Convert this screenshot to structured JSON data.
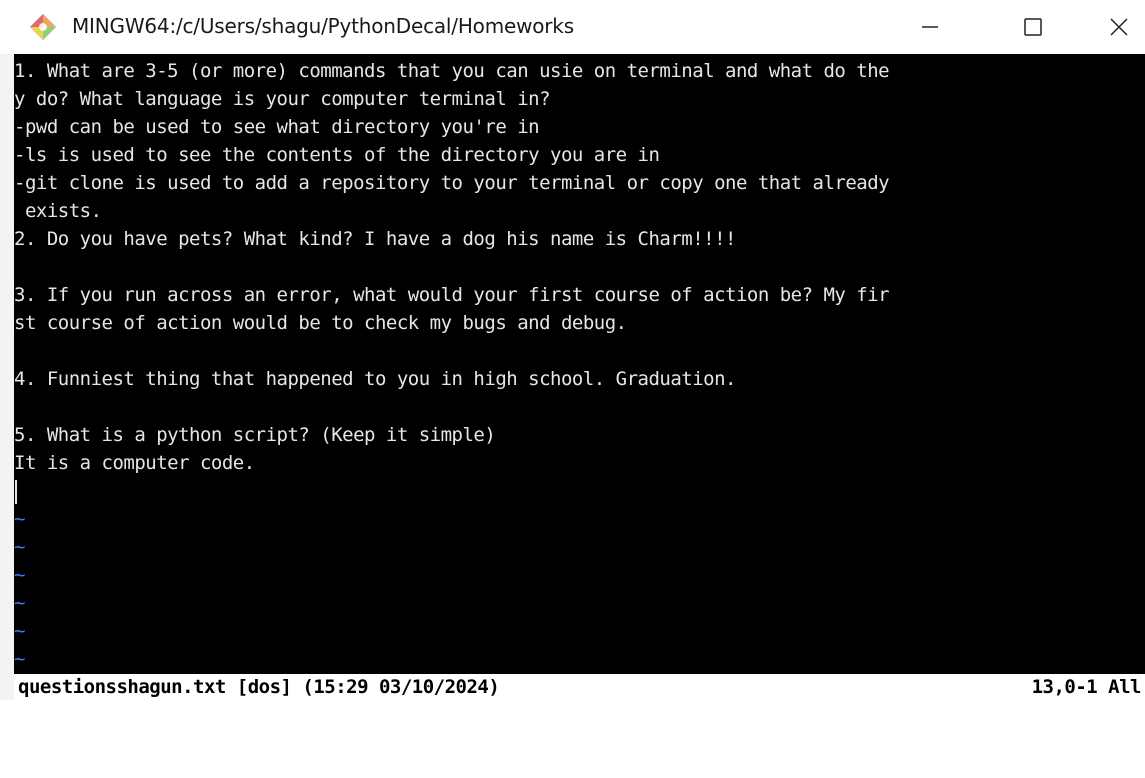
{
  "window": {
    "title": "MINGW64:/c/Users/shagu/PythonDecal/Homeworks",
    "app_icon": "git-diamond-icon",
    "controls": [
      "minimize-icon",
      "maximize-icon",
      "close-icon"
    ]
  },
  "editor": {
    "lines": [
      "1. What are 3-5 (or more) commands that you can usie on terminal and what do the",
      "y do? What language is your computer terminal in?",
      "-pwd can be used to see what directory you're in",
      "-ls is used to see the contents of the directory you are in",
      "-git clone is used to add a repository to your terminal or copy one that already",
      " exists.",
      "2. Do you have pets? What kind? I have a dog his name is Charm!!!!",
      "",
      "3. If you run across an error, what would your first course of action be? My fir",
      "st course of action would be to check my bugs and debug.",
      "",
      "4. Funniest thing that happened to you in high school. Graduation.",
      "",
      "5. What is a python script? (Keep it simple)",
      "It is a computer code.",
      ""
    ],
    "empty_marker": "~",
    "empty_rows": 6
  },
  "status": {
    "file_info": "questionsshagun.txt [dos] (15:29 03/10/2024)",
    "position": "13,0-1 All"
  },
  "colors": {
    "terminal_bg": "#000000",
    "text": "#e6e6e6",
    "tilde": "#3f78ff",
    "status_bg": "#ffffff"
  }
}
